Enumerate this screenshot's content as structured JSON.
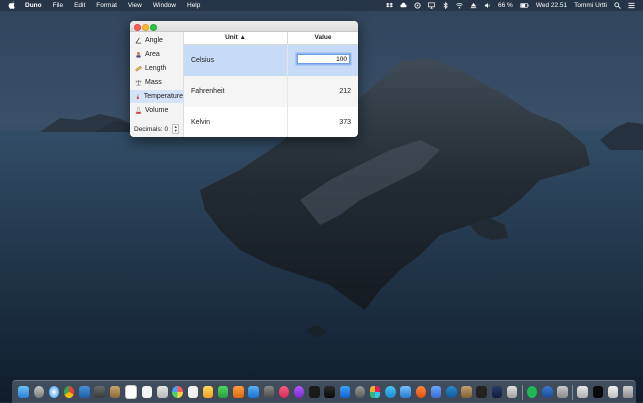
{
  "menubar": {
    "app_name": "Duno",
    "menus": [
      "File",
      "Edit",
      "Format",
      "View",
      "Window",
      "Help"
    ],
    "battery": "66 %",
    "clock": "Wed 22.51",
    "user": "Tommi Urtti"
  },
  "sidebar": {
    "items": [
      {
        "label": "Angle",
        "icon": "angle-icon"
      },
      {
        "label": "Area",
        "icon": "area-icon"
      },
      {
        "label": "Length",
        "icon": "ruler-icon"
      },
      {
        "label": "Mass",
        "icon": "scale-icon"
      },
      {
        "label": "Temperature",
        "icon": "thermometer-icon"
      },
      {
        "label": "Volume",
        "icon": "flask-icon"
      }
    ],
    "selected": "Temperature",
    "decimals_label": "Decimals:",
    "decimals_value": "0"
  },
  "table": {
    "columns": [
      "Unit ▲",
      "Value"
    ],
    "rows": [
      {
        "unit": "Celsius",
        "value": "100"
      },
      {
        "unit": "Fahrenheit",
        "value": "212"
      },
      {
        "unit": "Kelvin",
        "value": "373"
      }
    ]
  },
  "colors": {
    "selection": "#c7dbf6",
    "sidebar_selection": "#d4e3f7",
    "focus_ring": "#6a9fe0"
  }
}
